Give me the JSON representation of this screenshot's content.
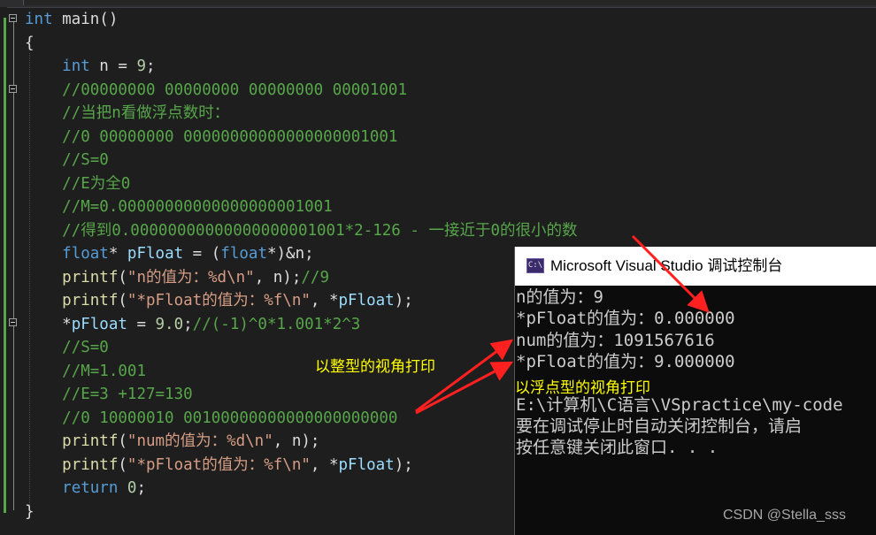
{
  "editor": {
    "lines": [
      [
        {
          "c": "kw",
          "t": "int"
        },
        {
          "c": "",
          "t": " main()"
        }
      ],
      [
        {
          "c": "",
          "t": "{"
        }
      ],
      [
        {
          "c": "",
          "t": "    "
        },
        {
          "c": "kw",
          "t": "int"
        },
        {
          "c": "",
          "t": " n = "
        },
        {
          "c": "num",
          "t": "9"
        },
        {
          "c": "",
          "t": ";"
        }
      ],
      [
        {
          "c": "",
          "t": "    "
        },
        {
          "c": "cm",
          "t": "//00000000 00000000 00000000 00001001"
        }
      ],
      [
        {
          "c": "",
          "t": "    "
        },
        {
          "c": "cm",
          "t": "//当把n看做浮点数时："
        }
      ],
      [
        {
          "c": "",
          "t": "    "
        },
        {
          "c": "cm",
          "t": "//0 00000000 00000000000000000001001"
        }
      ],
      [
        {
          "c": "",
          "t": "    "
        },
        {
          "c": "cm",
          "t": "//S=0"
        }
      ],
      [
        {
          "c": "",
          "t": "    "
        },
        {
          "c": "cm",
          "t": "//E为全0"
        }
      ],
      [
        {
          "c": "",
          "t": "    "
        },
        {
          "c": "cm",
          "t": "//M=0.00000000000000000001001"
        }
      ],
      [
        {
          "c": "",
          "t": "    "
        },
        {
          "c": "cm",
          "t": "//得到0.00000000000000000001001*2-126 - 一接近于0的很小的数"
        }
      ],
      [
        {
          "c": "",
          "t": "    "
        },
        {
          "c": "kw",
          "t": "float"
        },
        {
          "c": "",
          "t": "* "
        },
        {
          "c": "var",
          "t": "pFloat"
        },
        {
          "c": "",
          "t": " = ("
        },
        {
          "c": "kw",
          "t": "float"
        },
        {
          "c": "",
          "t": "*)&n;"
        }
      ],
      [
        {
          "c": "",
          "t": "    "
        },
        {
          "c": "fn",
          "t": "printf"
        },
        {
          "c": "",
          "t": "("
        },
        {
          "c": "str",
          "t": "\"n的值为：%d\\n\""
        },
        {
          "c": "",
          "t": ", n);"
        },
        {
          "c": "cm",
          "t": "//9"
        }
      ],
      [
        {
          "c": "",
          "t": "    "
        },
        {
          "c": "fn",
          "t": "printf"
        },
        {
          "c": "",
          "t": "("
        },
        {
          "c": "str",
          "t": "\"*pFloat的值为：%f\\n\""
        },
        {
          "c": "",
          "t": ", *"
        },
        {
          "c": "var",
          "t": "pFloat"
        },
        {
          "c": "",
          "t": ");"
        }
      ],
      [
        {
          "c": "",
          "t": "    *"
        },
        {
          "c": "var",
          "t": "pFloat"
        },
        {
          "c": "",
          "t": " = "
        },
        {
          "c": "num",
          "t": "9.0"
        },
        {
          "c": "",
          "t": ";"
        },
        {
          "c": "cm",
          "t": "//(-1)^0*1.001*2^3"
        }
      ],
      [
        {
          "c": "",
          "t": "    "
        },
        {
          "c": "cm",
          "t": "//S=0"
        }
      ],
      [
        {
          "c": "",
          "t": "    "
        },
        {
          "c": "cm",
          "t": "//M=1.001"
        }
      ],
      [
        {
          "c": "",
          "t": "    "
        },
        {
          "c": "cm",
          "t": "//E=3 +127=130"
        }
      ],
      [
        {
          "c": "",
          "t": "    "
        },
        {
          "c": "cm",
          "t": "//0 10000010 00100000000000000000000"
        }
      ],
      [
        {
          "c": "",
          "t": "    "
        },
        {
          "c": "fn",
          "t": "printf"
        },
        {
          "c": "",
          "t": "("
        },
        {
          "c": "str",
          "t": "\"num的值为：%d\\n\""
        },
        {
          "c": "",
          "t": ", n);"
        }
      ],
      [
        {
          "c": "",
          "t": "    "
        },
        {
          "c": "fn",
          "t": "printf"
        },
        {
          "c": "",
          "t": "("
        },
        {
          "c": "str",
          "t": "\"*pFloat的值为：%f\\n\""
        },
        {
          "c": "",
          "t": ", *"
        },
        {
          "c": "var",
          "t": "pFloat"
        },
        {
          "c": "",
          "t": ");"
        }
      ],
      [
        {
          "c": "",
          "t": "    "
        },
        {
          "c": "kw",
          "t": "return"
        },
        {
          "c": "",
          "t": " "
        },
        {
          "c": "num",
          "t": "0"
        },
        {
          "c": "",
          "t": ";"
        }
      ],
      [
        {
          "c": "",
          "t": "}"
        }
      ]
    ]
  },
  "console": {
    "icon_text": "C:\\",
    "title": "Microsoft Visual Studio 调试控制台",
    "lines": [
      "n的值为：9",
      "*pFloat的值为：0.000000",
      "num的值为：1091567616",
      "*pFloat的值为：9.000000",
      "",
      "E:\\计算机\\C语言\\VSpractice\\my-code",
      "要在调试停止时自动关闭控制台，请启",
      "按任意键关闭此窗口. . ."
    ]
  },
  "annotations": {
    "integer_view": "以整型的视角打印",
    "float_view": "以浮点型的视角打印",
    "color": "#ffff00",
    "arrow_color": "#ff2020"
  },
  "watermark": "CSDN @Stella_sss"
}
